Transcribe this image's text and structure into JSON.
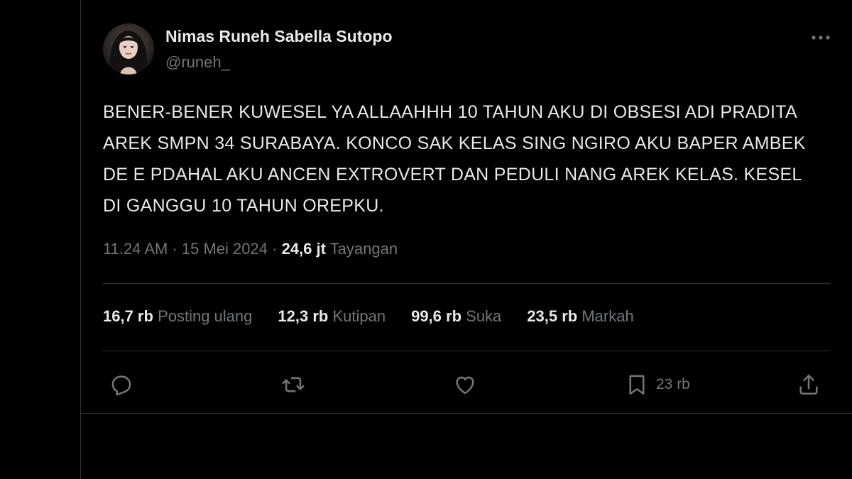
{
  "author": {
    "name": "Nimas Runeh Sabella Sutopo",
    "handle": "@runeh_"
  },
  "tweet": {
    "text": "BENER-BENER KUWESEL YA ALLAAHHH 10 TAHUN AKU DI OBSESI ADI PRADITA AREK SMPN 34 SURABAYA. KONCO SAK KELAS SING NGIRO AKU BAPER AMBEK DE E PDAHAL AKU ANCEN EXTROVERT DAN PEDULI NANG AREK KELAS. KESEL DI GANGGU 10 TAHUN OREPKU.",
    "time": "11.24 AM",
    "separator": "·",
    "date": "15 Mei 2024",
    "views_count": "24,6 jt",
    "views_label": "Tayangan"
  },
  "stats": [
    {
      "count": "16,7 rb",
      "label": "Posting ulang"
    },
    {
      "count": "12,3 rb",
      "label": "Kutipan"
    },
    {
      "count": "99,6 rb",
      "label": "Suka"
    },
    {
      "count": "23,5 rb",
      "label": "Markah"
    }
  ],
  "actions": {
    "reply_icon": "reply-icon",
    "repost_icon": "repost-icon",
    "like_icon": "heart-icon",
    "bookmark_icon": "bookmark-icon",
    "bookmark_count": "23 rb",
    "share_icon": "share-icon"
  },
  "colors": {
    "background": "#000000",
    "text": "#e7e9ea",
    "muted": "#71767b",
    "border": "#2f3336"
  }
}
